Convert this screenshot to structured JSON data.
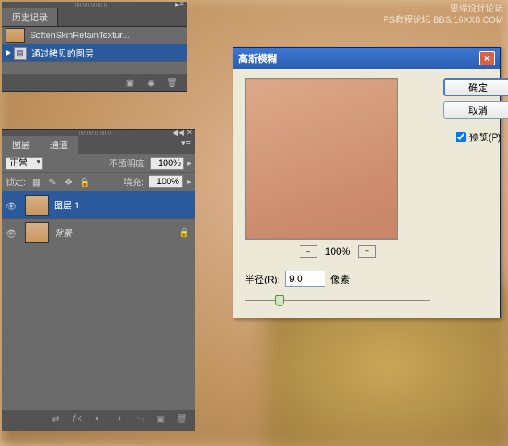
{
  "watermark": {
    "line1": "思缘设计论坛",
    "line2": "PS教程论坛",
    "line3": "BBS.16XX8.COM"
  },
  "history": {
    "title": "历史记录",
    "items": [
      {
        "label": "SoftenSkinRetainTextur..."
      },
      {
        "label": "通过拷贝的图层"
      }
    ]
  },
  "layers": {
    "tab_layers": "图层",
    "tab_channels": "通道",
    "blend_mode": "正常",
    "opacity_label": "不透明度:",
    "opacity_value": "100%",
    "lock_label": "锁定:",
    "fill_label": "填充:",
    "fill_value": "100%",
    "items": [
      {
        "name": "图层 1",
        "locked": false
      },
      {
        "name": "背景",
        "locked": true
      }
    ]
  },
  "dialog": {
    "title": "高斯模糊",
    "ok": "确定",
    "cancel": "取消",
    "preview_label": "预览(P)",
    "preview_checked": true,
    "zoom": "100%",
    "radius_label": "半径(R):",
    "radius_value": "9.0",
    "radius_unit": "像素"
  }
}
